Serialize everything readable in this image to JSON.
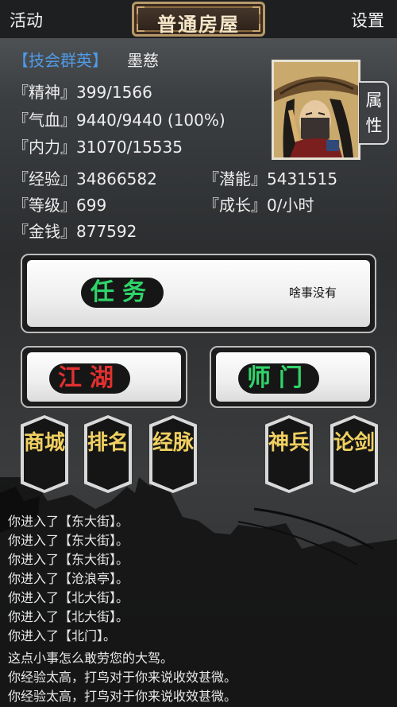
{
  "header": {
    "left_label": "活动",
    "title": "普通房屋",
    "right_label": "设置"
  },
  "player": {
    "faction": "【技会群英】",
    "name": "墨慈"
  },
  "stats": {
    "spirit_label": "『精神』",
    "spirit_value": "399/1566",
    "hp_label": "『气血』",
    "hp_value": "9440/9440 (100%)",
    "neili_label": "『内力』",
    "neili_value": "31070/15535",
    "exp_label": "『经验』",
    "exp_value": "34866582",
    "potential_label": "『潜能』",
    "potential_value": "5431515",
    "level_label": "『等级』",
    "level_value": "699",
    "growth_label": "『成长』",
    "growth_value": "0/小时",
    "money_label": "『金钱』",
    "money_value": "877592"
  },
  "attr_tab": "属性",
  "task": {
    "label": "任务",
    "status": "啥事没有"
  },
  "buttons": {
    "jianghu": "江湖",
    "shimen": "师门"
  },
  "hex_buttons": [
    {
      "label": "商城"
    },
    {
      "label": "排名"
    },
    {
      "label": "经脉"
    },
    {
      "label": "神兵"
    },
    {
      "label": "论剑"
    }
  ],
  "log": [
    "你进入了【东大街】。",
    "你进入了【东大街】。",
    "你进入了【东大街】。",
    "你进入了【沧浪亭】。",
    "你进入了【北大街】。",
    "你进入了【北大街】。",
    "你进入了【北门】。",
    "这点小事怎么敢劳您的大驾。",
    "你经验太高，打鸟对于你来说收效甚微。",
    "你经验太高，打鸟对于你来说收效甚微。"
  ],
  "colors": {
    "faction": "#4f9be8",
    "task_green": "#2fd46a",
    "jianghu_red": "#e03030",
    "hex_gold": "#f0d060"
  }
}
